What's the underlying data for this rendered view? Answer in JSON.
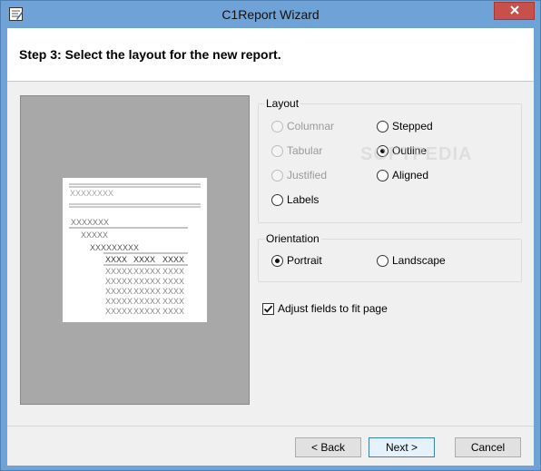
{
  "window": {
    "title": "C1Report Wizard",
    "accent_color": "#6fa3d8",
    "close_icon": "close-icon"
  },
  "header": {
    "step_title": "Step 3: Select the layout for the new report."
  },
  "preview": {
    "background_color": "#a8a8a8",
    "title_placeholder": "XXXXXXXX",
    "group_level_1": "XXXXXXX",
    "group_level_2": "XXXXX",
    "group_level_3": "XXXXXXXXX",
    "column_headers": [
      "XXXX",
      "XXXX",
      "XXXX"
    ],
    "detail_rows": [
      [
        "XXXXX",
        "XXXXX",
        "XXXX"
      ],
      [
        "XXXXX",
        "XXXXX",
        "XXXX"
      ],
      [
        "XXXXX",
        "XXXXX",
        "XXXX"
      ],
      [
        "XXXXX",
        "XXXXX",
        "XXXX"
      ],
      [
        "XXXXX",
        "XXXXX",
        "XXXX"
      ]
    ]
  },
  "layout": {
    "legend": "Layout",
    "options": [
      {
        "label": "Columnar",
        "checked": false,
        "enabled": false
      },
      {
        "label": "Stepped",
        "checked": false,
        "enabled": true
      },
      {
        "label": "Tabular",
        "checked": false,
        "enabled": false
      },
      {
        "label": "Outline",
        "checked": true,
        "enabled": true
      },
      {
        "label": "Justified",
        "checked": false,
        "enabled": false
      },
      {
        "label": "Aligned",
        "checked": false,
        "enabled": true
      },
      {
        "label": "Labels",
        "checked": false,
        "enabled": true
      }
    ]
  },
  "orientation": {
    "legend": "Orientation",
    "options": [
      {
        "label": "Portrait",
        "checked": true
      },
      {
        "label": "Landscape",
        "checked": false
      }
    ]
  },
  "adjust_fields": {
    "label": "Adjust fields to fit page",
    "checked": true
  },
  "buttons": {
    "back": "< Back",
    "next": "Next >",
    "cancel": "Cancel"
  },
  "watermark": "SOFTPEDIA"
}
